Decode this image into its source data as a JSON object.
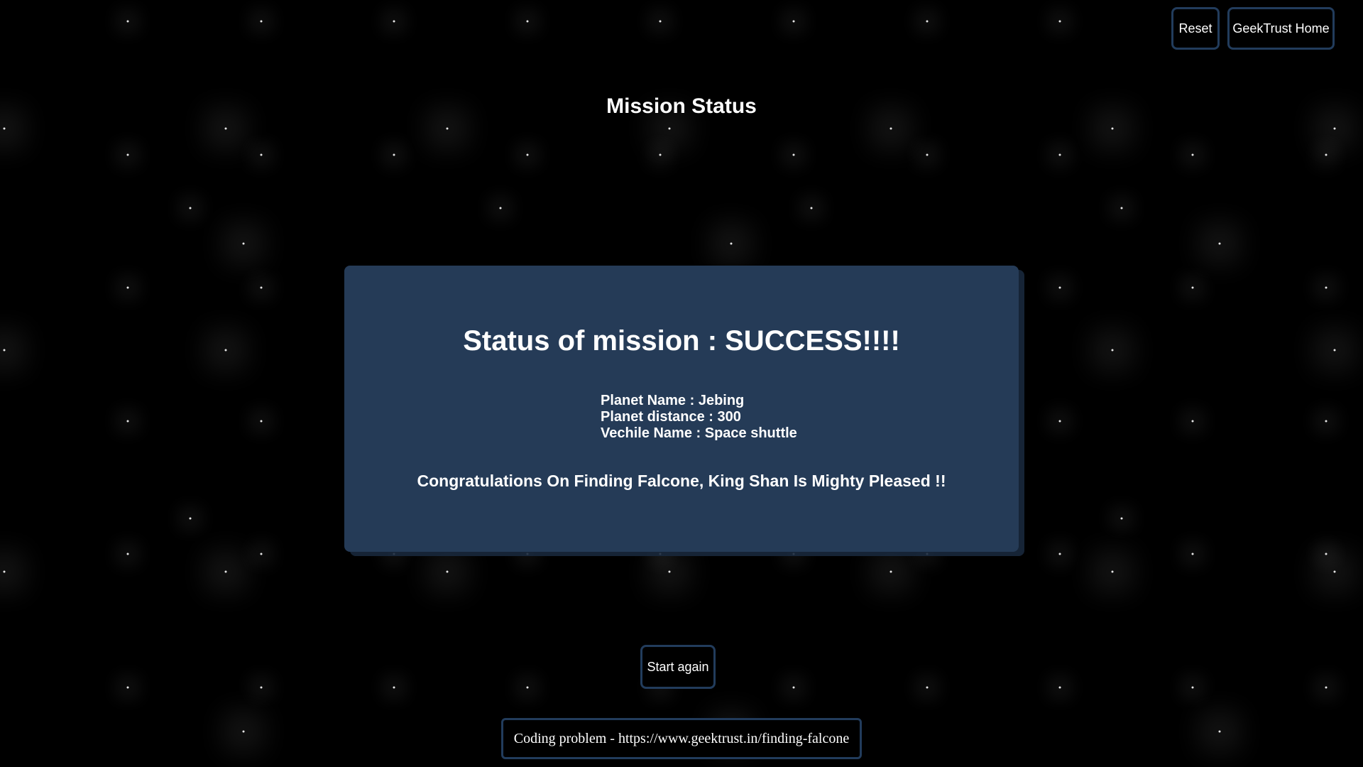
{
  "header": {
    "reset_label": "Reset",
    "home_label": "GeekTrust Home"
  },
  "page": {
    "title": "Mission Status"
  },
  "result": {
    "status_heading": "Status of mission : SUCCESS!!!!",
    "planet_name": "Planet Name : Jebing",
    "planet_distance": "Planet distance : 300",
    "vehicle_name": "Vechile Name : Space shuttle",
    "congrats": "Congratulations On Finding Falcone, King Shan Is Mighty Pleased !!"
  },
  "actions": {
    "start_again_label": "Start again"
  },
  "footer": {
    "text": "Coding problem - https://www.geektrust.in/finding-falcone"
  },
  "colors": {
    "background": "#000000",
    "card": "#253b57",
    "button_border": "#223c5c",
    "text": "#ffffff"
  }
}
